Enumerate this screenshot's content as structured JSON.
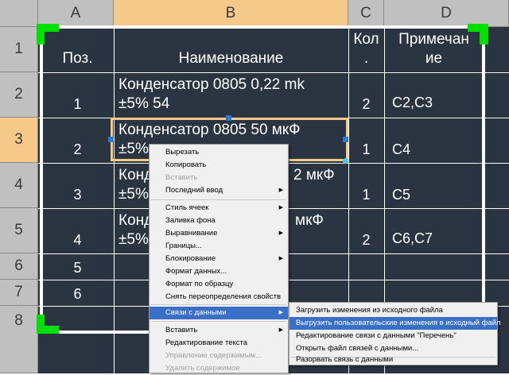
{
  "columns": [
    {
      "label": "A",
      "selected": false
    },
    {
      "label": "B",
      "selected": true
    },
    {
      "label": "C",
      "selected": false
    },
    {
      "label": "D",
      "selected": false
    }
  ],
  "rows": [
    {
      "label": "1",
      "selected": false
    },
    {
      "label": "2",
      "selected": false
    },
    {
      "label": "3",
      "selected": true
    },
    {
      "label": "4",
      "selected": false
    },
    {
      "label": "5",
      "selected": false
    },
    {
      "label": "6",
      "selected": false
    },
    {
      "label": "7",
      "selected": false
    },
    {
      "label": "8",
      "selected": false
    }
  ],
  "table": {
    "header": {
      "pos": "Поз.",
      "name": "Наименование",
      "qty_l1": "Кол",
      "qty_l2": ".",
      "note_l1": "Примечан",
      "note_l2": "ие"
    },
    "r2": {
      "pos": "1",
      "name_l1": "Конденсатор 0805 0,22 mk",
      "name_l2": "±5% 54",
      "qty": "2",
      "note": "C2,C3"
    },
    "r3": {
      "pos": "2",
      "name_l1": "Конденсатор 0805 50 мкФ",
      "name_l2": "±5%",
      "qty": "1",
      "note": "C4"
    },
    "r4": {
      "pos": "3",
      "name_l1": "Конд",
      "name_l1b": "2 мкФ",
      "name_l2": "±5%",
      "qty": "1",
      "note": "C5"
    },
    "r5": {
      "pos": "4",
      "name_l1": "Конд",
      "name_l1b": "мкФ",
      "name_l2": "±5%",
      "qty": "2",
      "note": "C6,C7"
    },
    "r6": {
      "pos": "5"
    },
    "r7": {
      "pos": "6"
    }
  },
  "context_menu": {
    "items": [
      {
        "label": "Вырезать",
        "disabled": false,
        "submenu": false
      },
      {
        "label": "Копировать",
        "disabled": false,
        "submenu": false
      },
      {
        "label": "Вставить",
        "disabled": true,
        "submenu": false
      },
      {
        "label": "Последний ввод",
        "disabled": false,
        "submenu": true
      },
      {
        "label": "Стиль ячеек",
        "disabled": false,
        "submenu": true
      },
      {
        "label": "Заливка фона",
        "disabled": false,
        "submenu": false
      },
      {
        "label": "Выравнивание",
        "disabled": false,
        "submenu": true
      },
      {
        "label": "Границы...",
        "disabled": false,
        "submenu": false
      },
      {
        "label": "Блокирование",
        "disabled": false,
        "submenu": true
      },
      {
        "label": "Формат данных...",
        "disabled": false,
        "submenu": false
      },
      {
        "label": "Формат по образцу",
        "disabled": false,
        "submenu": false
      },
      {
        "label": "Снять переопределения свойств",
        "disabled": false,
        "submenu": false
      },
      {
        "label": "Связи с данными",
        "disabled": false,
        "submenu": true,
        "highlighted": true
      },
      {
        "label": "Вставить",
        "disabled": false,
        "submenu": true
      },
      {
        "label": "Редактирование текста",
        "disabled": false,
        "submenu": false
      },
      {
        "label": "Управление содержимым...",
        "disabled": true,
        "submenu": false
      },
      {
        "label": "Удалить содержимое",
        "disabled": true,
        "submenu": false
      }
    ]
  },
  "submenu": {
    "items": [
      {
        "label": "Загрузить изменения из исходного файла",
        "highlighted": false
      },
      {
        "label": "Выгрузить пользовательские изменения в исходный файл",
        "highlighted": true
      },
      {
        "label": "Редактирование связи с данными \"Перечень\"",
        "highlighted": false
      },
      {
        "label": "Открыть файл связей с данными...",
        "highlighted": false
      },
      {
        "label": "Разорвать связь с данными",
        "highlighted": false
      }
    ]
  },
  "colors": {
    "background": "#2b3542",
    "selection": "#f5c98a",
    "grip": "#00e000",
    "menu_highlight": "#3a6fc8"
  }
}
